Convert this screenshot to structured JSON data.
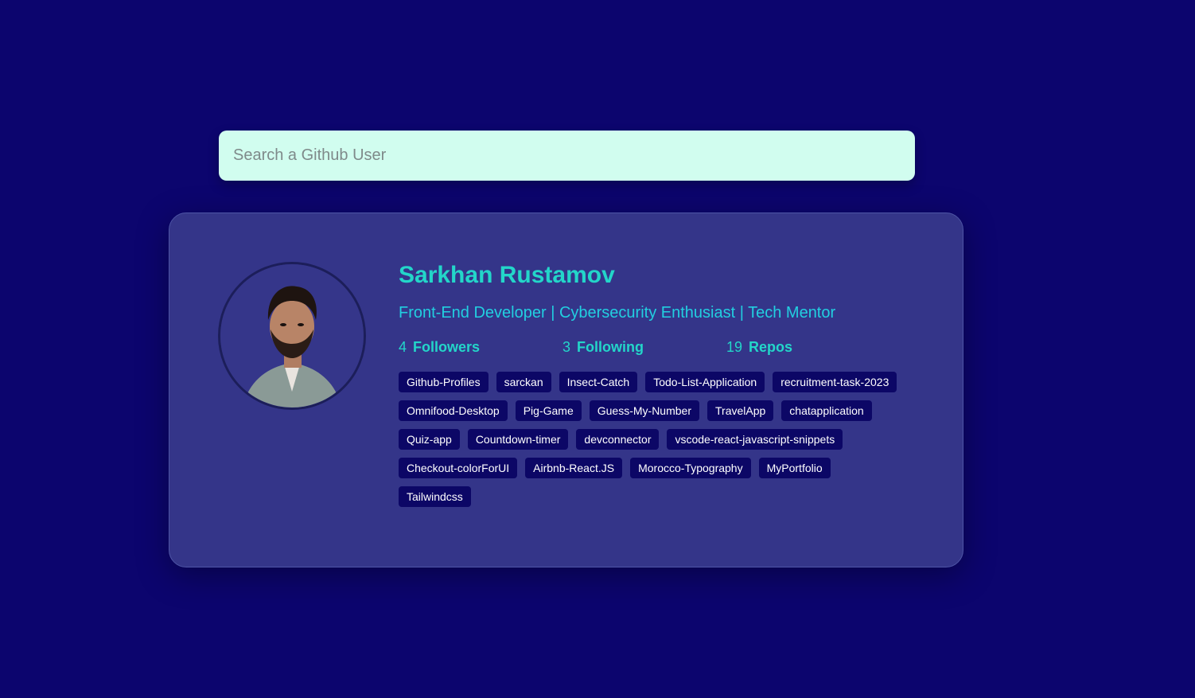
{
  "search": {
    "placeholder": "Search a Github User",
    "value": ""
  },
  "profile": {
    "name": "Sarkhan Rustamov",
    "bio": "Front-End Developer | Cybersecurity Enthusiast | Tech Mentor",
    "stats": {
      "followers": {
        "count": "4",
        "label": "Followers"
      },
      "following": {
        "count": "3",
        "label": "Following"
      },
      "repos": {
        "count": "19",
        "label": "Repos"
      }
    },
    "avatar_icon": "profile-photo"
  },
  "repos": [
    "Github-Profiles",
    "sarckan",
    "Insect-Catch",
    "Todo-List-Application",
    "recruitment-task-2023",
    "Omnifood-Desktop",
    "Pig-Game",
    "Guess-My-Number",
    "TravelApp",
    "chatapplication",
    "Quiz-app",
    "Countdown-timer",
    "devconnector",
    "vscode-react-javascript-snippets",
    "Checkout-colorForUI",
    "Airbnb-React.JS",
    "Morocco-Typography",
    "MyPortfolio",
    "Tailwindcss"
  ],
  "colors": {
    "background": "#0c056e",
    "card": "#343589",
    "accent": "#23d6c9",
    "search_bg": "#d1fdef",
    "tag_bg": "#0c0766"
  }
}
